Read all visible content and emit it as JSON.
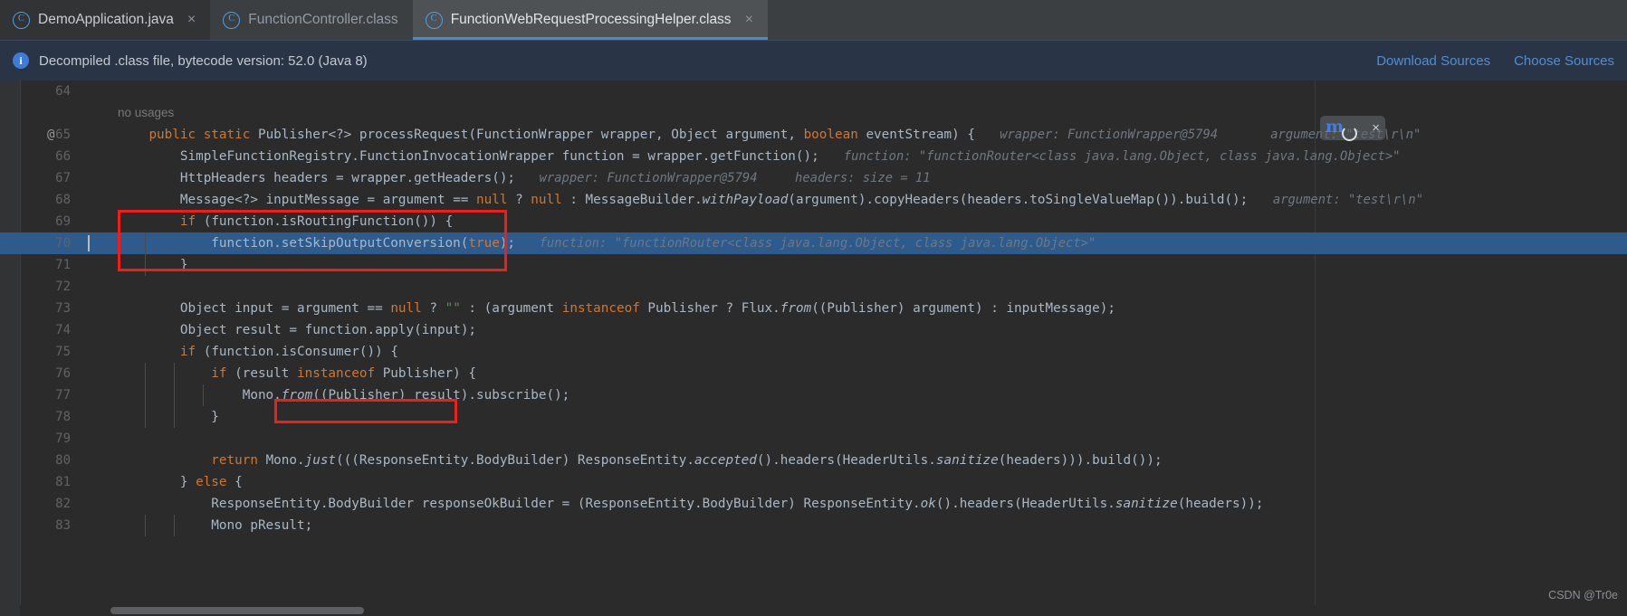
{
  "tabs": [
    {
      "label": "DemoApplication.java",
      "icon": "class-file-icon",
      "state": "first",
      "closable": true
    },
    {
      "label": "FunctionController.class",
      "icon": "class-file-icon",
      "state": "inactive",
      "closable": false
    },
    {
      "label": "FunctionWebRequestProcessingHelper.class",
      "icon": "class-file-icon",
      "state": "active",
      "closable": true
    }
  ],
  "tab_close_glyph": "×",
  "class_icon_glyph": "C",
  "notification": {
    "icon": "info-icon",
    "icon_glyph": "i",
    "message": "Decompiled .class file, bytecode version: 52.0 (Java 8)",
    "actions": [
      {
        "label": "Download Sources"
      },
      {
        "label": "Choose Sources"
      }
    ]
  },
  "overlay_widget": {
    "logo_glyph": "m",
    "close_glyph": "×",
    "refresh_icon": "refresh-icon"
  },
  "watermark": "CSDN @Tr0e",
  "colors": {
    "accent": "#4a88c7",
    "link": "#4e8fd4",
    "annotation_box": "#f01e14",
    "selection": "#2f5b8c",
    "editor_bg": "#2b2b2b",
    "tabbar_bg": "#3c3f41",
    "notification_bg": "#293446",
    "keyword": "#cc7832",
    "method": "#ffc66d",
    "string": "#6a8759",
    "number": "#6897bb",
    "plain": "#a9b7c6",
    "hint": "#6f7780"
  },
  "annotations": {
    "boxes": [
      {
        "name": "routing-function-block-box",
        "lines": "69-71"
      },
      {
        "name": "function-apply-box",
        "lines": "74"
      }
    ]
  },
  "editor": {
    "selected_line": 70,
    "lines": [
      {
        "num": "64",
        "marker": "",
        "annotation": "",
        "code": "",
        "hint": ""
      },
      {
        "num": "",
        "marker": "",
        "annotation": "no usages",
        "code": "",
        "hint": ""
      },
      {
        "num": "65",
        "marker": "@",
        "annotation": "",
        "code": "    public static Publisher<?> processRequest(FunctionWrapper wrapper, Object argument, boolean eventStream) {",
        "hint": "wrapper: FunctionWrapper@5794       argument: \"test\\r\\n\""
      },
      {
        "num": "66",
        "marker": "",
        "annotation": "",
        "code": "        SimpleFunctionRegistry.FunctionInvocationWrapper function = wrapper.getFunction();",
        "hint": "function: \"functionRouter<class java.lang.Object, class java.lang.Object>\""
      },
      {
        "num": "67",
        "marker": "",
        "annotation": "",
        "code": "        HttpHeaders headers = wrapper.getHeaders();",
        "hint": "wrapper: FunctionWrapper@5794     headers: size = 11"
      },
      {
        "num": "68",
        "marker": "",
        "annotation": "",
        "code": "        Message<?> inputMessage = argument == null ? null : MessageBuilder.withPayload(argument).copyHeaders(headers.toSingleValueMap()).build();",
        "hint": "argument: \"test\\r\\n\""
      },
      {
        "num": "69",
        "marker": "",
        "annotation": "",
        "code": "        if (function.isRoutingFunction()) {",
        "hint": ""
      },
      {
        "num": "70",
        "marker": "",
        "annotation": "",
        "code": "            function.setSkipOutputConversion(true);",
        "hint": "function: \"functionRouter<class java.lang.Object, class java.lang.Object>\""
      },
      {
        "num": "71",
        "marker": "",
        "annotation": "",
        "code": "        }",
        "hint": ""
      },
      {
        "num": "72",
        "marker": "",
        "annotation": "",
        "code": "",
        "hint": ""
      },
      {
        "num": "73",
        "marker": "",
        "annotation": "",
        "code": "        Object input = argument == null ? \"\" : (argument instanceof Publisher ? Flux.from((Publisher) argument) : inputMessage);",
        "hint": ""
      },
      {
        "num": "74",
        "marker": "",
        "annotation": "",
        "code": "        Object result = function.apply(input);",
        "hint": ""
      },
      {
        "num": "75",
        "marker": "",
        "annotation": "",
        "code": "        if (function.isConsumer()) {",
        "hint": ""
      },
      {
        "num": "76",
        "marker": "",
        "annotation": "",
        "code": "            if (result instanceof Publisher) {",
        "hint": ""
      },
      {
        "num": "77",
        "marker": "",
        "annotation": "",
        "code": "                Mono.from((Publisher) result).subscribe();",
        "hint": ""
      },
      {
        "num": "78",
        "marker": "",
        "annotation": "",
        "code": "            }",
        "hint": ""
      },
      {
        "num": "79",
        "marker": "",
        "annotation": "",
        "code": "",
        "hint": ""
      },
      {
        "num": "80",
        "marker": "",
        "annotation": "",
        "code": "            return Mono.just(((ResponseEntity.BodyBuilder) ResponseEntity.accepted().headers(HeaderUtils.sanitize(headers))).build());",
        "hint": ""
      },
      {
        "num": "81",
        "marker": "",
        "annotation": "",
        "code": "        } else {",
        "hint": ""
      },
      {
        "num": "82",
        "marker": "",
        "annotation": "",
        "code": "            ResponseEntity.BodyBuilder responseOkBuilder = (ResponseEntity.BodyBuilder) ResponseEntity.ok().headers(HeaderUtils.sanitize(headers));",
        "hint": ""
      },
      {
        "num": "83",
        "marker": "",
        "annotation": "",
        "code": "            Mono pResult;",
        "hint": ""
      }
    ]
  }
}
